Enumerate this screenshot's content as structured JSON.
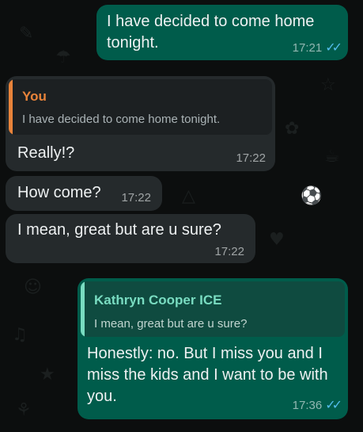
{
  "colors": {
    "outgoing_bubble": "#005c4b",
    "incoming_bubble": "#252a2c",
    "read_ticks": "#53bdeb",
    "you_quote_accent": "#e8833a",
    "contact_quote_accent": "#79dcc1"
  },
  "messages": [
    {
      "text": "I have decided to come home tonight.",
      "time": "17:21",
      "status_icon": "double-check-icon"
    },
    {
      "quote_name": "You",
      "quote_text": "I have decided to come home tonight.",
      "text": "Really!?",
      "time": "17:22"
    },
    {
      "text": "How come?",
      "time": "17:22"
    },
    {
      "text": "I mean, great but are u sure?",
      "time": "17:22"
    },
    {
      "quote_name": "Kathryn Cooper ICE",
      "quote_text": "I mean, great but are u sure?",
      "text": "Honestly: no. But I miss you and I miss the kids and I want to be with you.",
      "time": "17:36",
      "status_icon": "double-check-icon"
    }
  ]
}
